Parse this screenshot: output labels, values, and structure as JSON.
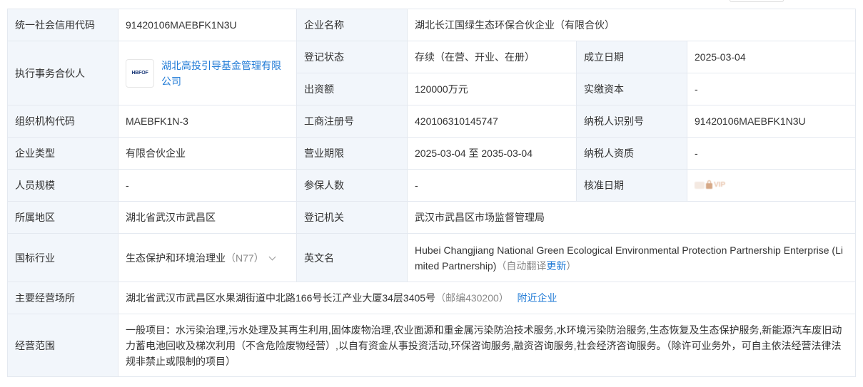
{
  "rows": {
    "credit_code": {
      "label": "统一社会信用代码",
      "value": "91420106MAEBFK1N3U"
    },
    "company_name": {
      "label": "企业名称",
      "value": "湖北长江国绿生态环保合伙企业（有限合伙）"
    },
    "partner": {
      "label": "执行事务合伙人",
      "logo_text": "HBFOF",
      "name": "湖北高投引导基金管理有限公司"
    },
    "reg_status": {
      "label": "登记状态",
      "value": "存续（在营、开业、在册）"
    },
    "est_date": {
      "label": "成立日期",
      "value": "2025-03-04"
    },
    "capital": {
      "label": "出资额",
      "value": "120000万元"
    },
    "paid_capital": {
      "label": "实缴资本",
      "value": "-"
    },
    "org_code": {
      "label": "组织机构代码",
      "value": "MAEBFK1N-3"
    },
    "biz_reg_no": {
      "label": "工商注册号",
      "value": "420106310145747"
    },
    "taxpayer_id": {
      "label": "纳税人识别号",
      "value": "91420106MAEBFK1N3U"
    },
    "company_type": {
      "label": "企业类型",
      "value": "有限合伙企业"
    },
    "biz_term": {
      "label": "营业期限",
      "value": "2025-03-04 至 2035-03-04"
    },
    "taxpayer_qual": {
      "label": "纳税人资质",
      "value": "-"
    },
    "staff_size": {
      "label": "人员规模",
      "value": "-"
    },
    "insured": {
      "label": "参保人数",
      "value": "-"
    },
    "approval_date": {
      "label": "核准日期",
      "vip_text": "VIP",
      "vip_icon": "lock-icon"
    },
    "region": {
      "label": "所属地区",
      "value": "湖北省武汉市武昌区"
    },
    "reg_authority": {
      "label": "登记机关",
      "value": "武汉市武昌区市场监督管理局"
    },
    "industry": {
      "label": "国标行业",
      "value": "生态保护和环境治理业",
      "code": "（N77）"
    },
    "english_name": {
      "label": "英文名",
      "value": "Hubei Changjiang National Green Ecological Environmental Protection Partnership Enterprise (Limited Partnership)",
      "auto_prefix": "（自动翻译",
      "update_link": "更新",
      "auto_suffix": "）"
    },
    "address": {
      "label": "主要经营场所",
      "value": "湖北省武汉市武昌区水果湖街道中北路166号长江产业大厦34层3405号",
      "postcode": "（邮编430200）",
      "nearby_link": "附近企业"
    },
    "scope": {
      "label": "经营范围",
      "value": "一般项目：水污染治理,污水处理及其再生利用,固体废物治理,农业面源和重金属污染防治技术服务,水环境污染防治服务,生态恢复及生态保护服务,新能源汽车废旧动力蓄电池回收及梯次利用（不含危险废物经营）,以自有资金从事投资活动,环保咨询服务,融资咨询服务,社会经济咨询服务。（除许可业务外，可自主依法经营法律法规非禁止或限制的项目）"
    }
  }
}
